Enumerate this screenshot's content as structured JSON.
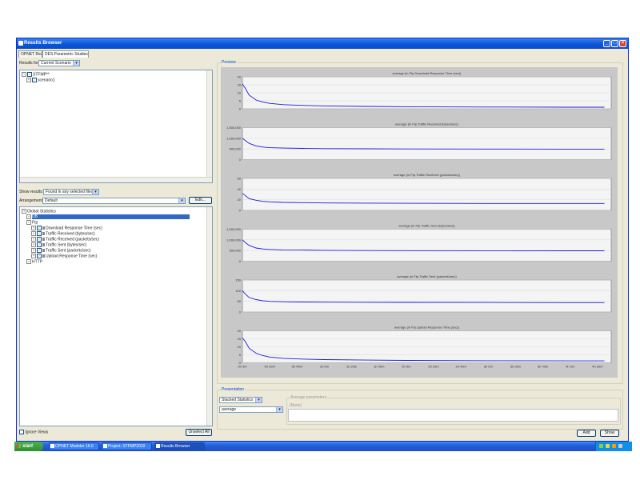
{
  "window": {
    "title": "Results Browser",
    "tabs": [
      "OPNET Results",
      "DES Parametric Studies"
    ]
  },
  "left": {
    "results_for_label": "Results for:",
    "results_for_value": "Current Scenario",
    "tree_top": [
      {
        "label": "STFMP**",
        "checked": true,
        "expanded": true
      },
      {
        "label": "scenario1",
        "checked": true,
        "expanded": false
      }
    ],
    "show_results_label": "Show results:",
    "show_results_value": "Found in any selected files",
    "arrangement_label": "Arrangement:",
    "arrangement_value": "Default",
    "arrangement_button": "Edit...",
    "stats_tree": [
      {
        "label": "Global Statistics",
        "level": 0,
        "checked": false
      },
      {
        "label": "DB",
        "level": 1,
        "checked": false,
        "selected": true
      },
      {
        "label": "Ftp",
        "level": 1,
        "checked": false
      },
      {
        "label": "Download Response Time (sec)",
        "level": 2,
        "checked": true
      },
      {
        "label": "Traffic Received (bytes/sec)",
        "level": 2,
        "checked": true
      },
      {
        "label": "Traffic Received (packets/sec)",
        "level": 2,
        "checked": true
      },
      {
        "label": "Traffic Sent (bytes/sec)",
        "level": 2,
        "checked": true
      },
      {
        "label": "Traffic Sent (packets/sec)",
        "level": 2,
        "checked": true
      },
      {
        "label": "Upload Response Time (sec)",
        "level": 2,
        "checked": true
      },
      {
        "label": "HTTP",
        "level": 1,
        "checked": false
      }
    ],
    "ignore_views_label": "Ignore Views",
    "unselect_all_button": "Unselect All"
  },
  "preview": {
    "title": "Preview",
    "x_ticks": [
      "0h 0m",
      "0h 20m",
      "0h 40m",
      "1h 0m",
      "1h 20m",
      "1h 40m",
      "2h 0m",
      "2h 20m",
      "2h 40m",
      "3h 0m",
      "3h 20m",
      "3h 40m",
      "4h 0m",
      "4h 20m"
    ]
  },
  "presentation": {
    "title": "Presentation",
    "mode_value": "Stacked Statistics",
    "filter_value": "average",
    "params_title": "Average parameters",
    "params_sub": "(None)",
    "add_button": "Add",
    "show_button": "Show"
  },
  "taskbar": {
    "start_label": "start",
    "tasks": [
      "OPNET Modeler 16.0",
      "Project: STFMP2010",
      "Results Browser"
    ]
  },
  "chart_data": [
    {
      "type": "line",
      "title": "average (in Ftp.Download Response Time (sec))",
      "x": [
        0,
        2,
        5,
        10,
        15,
        20,
        30,
        45,
        60,
        90,
        120,
        180,
        240,
        265
      ],
      "values": [
        15.5,
        13,
        8.5,
        5.5,
        4.2,
        3.4,
        2.6,
        2.1,
        1.8,
        1.5,
        1.3,
        1.1,
        1.0,
        1.0
      ],
      "yticks": [
        "20",
        "15",
        "10",
        "5",
        "0"
      ],
      "ylim": [
        0,
        20
      ],
      "color": "#1a1ad8"
    },
    {
      "type": "line",
      "title": "average (in Ftp.Traffic Received (bytes/sec))",
      "x": [
        0,
        2,
        5,
        10,
        15,
        20,
        30,
        45,
        60,
        90,
        120,
        180,
        240,
        265
      ],
      "values": [
        1000000,
        900000,
        760000,
        640000,
        590000,
        560000,
        540000,
        525000,
        515000,
        505000,
        500000,
        495000,
        492000,
        490000
      ],
      "yticks": [
        "1,500,000",
        "1,000,000",
        "500,000",
        "0"
      ],
      "ylim": [
        0,
        1500000
      ],
      "color": "#1a1ad8"
    },
    {
      "type": "line",
      "title": "average (in Ftp.Traffic Received (packets/sec))",
      "x": [
        0,
        2,
        5,
        10,
        15,
        20,
        30,
        45,
        60,
        90,
        120,
        180,
        240,
        265
      ],
      "values": [
        32,
        28,
        22,
        19,
        17,
        16,
        15,
        14.5,
        14,
        13.6,
        13.4,
        13.1,
        13,
        13
      ],
      "yticks": [
        "60",
        "40",
        "20",
        "0"
      ],
      "ylim": [
        0,
        60
      ],
      "color": "#1a1ad8"
    },
    {
      "type": "line",
      "title": "average (in Ftp.Traffic Sent (bytes/sec))",
      "x": [
        0,
        2,
        5,
        10,
        15,
        20,
        30,
        45,
        60,
        90,
        120,
        180,
        240,
        265
      ],
      "values": [
        1000000,
        880000,
        740000,
        620000,
        575000,
        550000,
        530000,
        520000,
        510000,
        500000,
        495000,
        490000,
        488000,
        486000
      ],
      "yticks": [
        "1,500,000",
        "1,000,000",
        "500,000",
        "0"
      ],
      "ylim": [
        0,
        1500000
      ],
      "color": "#1a1ad8"
    },
    {
      "type": "line",
      "title": "average (in Ftp.Traffic Sent (packets/sec))",
      "x": [
        0,
        2,
        5,
        10,
        15,
        20,
        30,
        45,
        60,
        90,
        120,
        180,
        240,
        265
      ],
      "values": [
        100,
        85,
        68,
        58,
        53,
        50,
        48,
        47,
        46,
        45.5,
        45,
        44.5,
        44,
        44
      ],
      "yticks": [
        "150",
        "100",
        "50",
        "0"
      ],
      "ylim": [
        0,
        150
      ],
      "color": "#1a1ad8"
    },
    {
      "type": "line",
      "title": "average (in Ftp.Upload Response Time (sec))",
      "x": [
        0,
        2,
        5,
        10,
        15,
        20,
        30,
        45,
        60,
        90,
        120,
        180,
        240,
        265
      ],
      "values": [
        15.5,
        13.5,
        9,
        6,
        4.5,
        3.6,
        2.8,
        2.3,
        2.0,
        1.7,
        1.5,
        1.3,
        1.2,
        1.2
      ],
      "yticks": [
        "20",
        "15",
        "10",
        "5",
        "0"
      ],
      "ylim": [
        0,
        20
      ],
      "color": "#1a1ad8"
    }
  ]
}
